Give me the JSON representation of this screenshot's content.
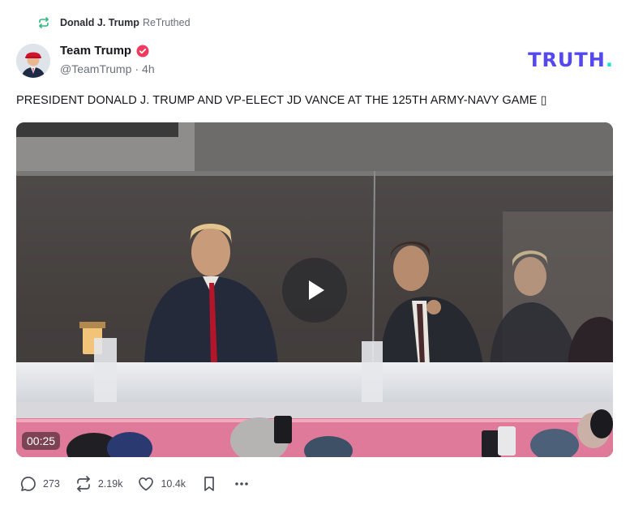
{
  "retruth": {
    "name": "Donald J. Trump",
    "suffix": "ReTruthed",
    "icon": "retruth-icon",
    "color": "#2eb87b"
  },
  "author": {
    "name": "Team Trump",
    "handle": "@TeamTrump",
    "separator": "·",
    "time": "4h",
    "verified_icon": "verified-badge-icon",
    "verified_color": "#ef3b5d"
  },
  "brand": {
    "logo_text": "TRUTH",
    "logo_dot": ".",
    "primary": "#5448ee",
    "accent": "#17e3c6"
  },
  "post": {
    "text": "PRESIDENT DONALD J. TRUMP AND VP-ELECT JD VANCE AT THE 125TH ARMY-NAVY GAME ▯"
  },
  "media": {
    "duration": "00:25",
    "play_icon": "play-icon"
  },
  "actions": {
    "replies": "273",
    "retruths": "2.19k",
    "likes": "10.4k",
    "icons": [
      "comment-icon",
      "retruth-icon",
      "heart-icon",
      "bookmark-icon",
      "more-icon"
    ]
  }
}
